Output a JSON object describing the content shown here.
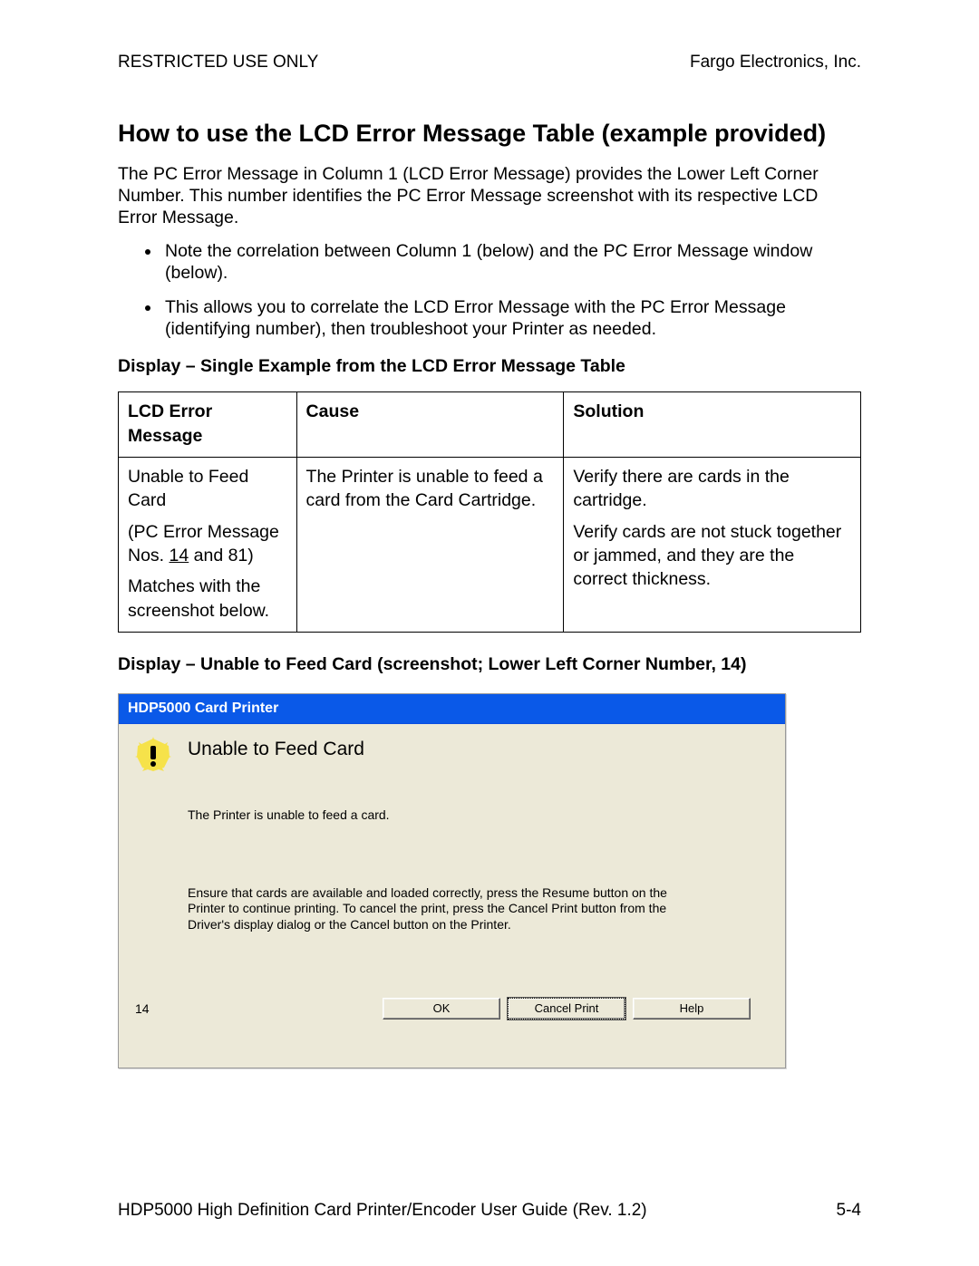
{
  "header": {
    "left": "RESTRICTED USE ONLY",
    "right": "Fargo Electronics, Inc."
  },
  "title": "How to use the LCD Error Message Table (example provided)",
  "intro": "The PC Error Message in Column 1 (LCD Error Message) provides the Lower Left Corner Number. This number identifies the PC Error Message screenshot with its respective LCD Error Message.",
  "bullets": [
    "Note the correlation between Column 1 (below) and the PC Error Message window (below).",
    "This allows you to correlate the LCD Error Message with the PC Error Message (identifying number), then troubleshoot your Printer as needed."
  ],
  "subhead1": "Display – Single Example from the LCD Error Message Table",
  "table": {
    "headers": {
      "c1": "LCD Error Message",
      "c2": "Cause",
      "c3": "Solution"
    },
    "row": {
      "lcd_line1": "Unable to Feed Card",
      "lcd_line2_prefix": "(PC Error Message Nos. ",
      "lcd_line2_underlined": "14",
      "lcd_line2_suffix": " and 81)",
      "lcd_line3": "Matches with the screenshot below.",
      "cause": "The Printer is unable to feed a card from the Card Cartridge.",
      "solution_p1": "Verify there are cards in the cartridge.",
      "solution_p2": "Verify cards are not stuck together or jammed, and they are the correct thickness."
    }
  },
  "subhead2": "Display – Unable to Feed Card (screenshot; Lower Left Corner Number, 14)",
  "dialog": {
    "title": "HDP5000 Card Printer",
    "heading": "Unable to Feed Card",
    "message": "The Printer is unable to feed a card.",
    "instructions": "Ensure that cards are available and loaded correctly, press the Resume button on the Printer to continue printing. To cancel the print, press the Cancel Print button from the Driver's display dialog or the Cancel button on the Printer.",
    "corner_number": "14",
    "buttons": {
      "ok": "OK",
      "cancel": "Cancel Print",
      "help": "Help"
    }
  },
  "footer": {
    "left": "HDP5000 High Definition Card Printer/Encoder User Guide (Rev. 1.2)",
    "right": "5-4"
  }
}
